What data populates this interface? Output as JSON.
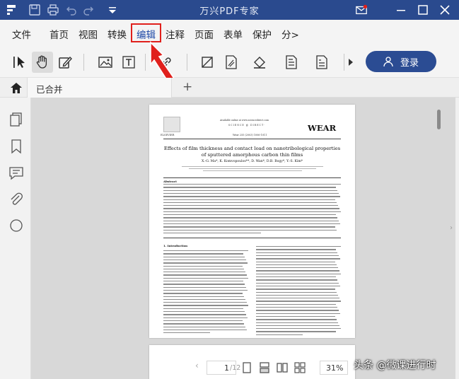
{
  "window": {
    "title": "万兴PDF专家"
  },
  "menu": {
    "file": "文件",
    "items": [
      "首页",
      "视图",
      "转换",
      "编辑",
      "注释",
      "页面",
      "表单",
      "保护"
    ],
    "more": "分>"
  },
  "toolbar": {
    "tools": [
      "select-arrow",
      "hand",
      "edit-pen",
      "image",
      "text-box",
      "link",
      "crop",
      "background",
      "watermark",
      "header-footer",
      "bates"
    ],
    "login_label": "登录"
  },
  "tabs": {
    "doc_tab_label": "已合并",
    "add_tab": "+"
  },
  "document": {
    "journal_info_top": "Available online at www.sciencedirect.com",
    "journal_name": "WEAR",
    "publisher": "ELSEVIER",
    "journal_citation": "Wear 255 (2003) 1006-1011",
    "paper_title": "Effects of film thickness and contact load on nanotribological properties of sputtered amorphous carbon thin films",
    "authors": "X.-G. Ma*, K. Komvopoulos**, D. Wan*, D.B. Bogy*, Y.-S. Kim*",
    "abstract_heading": "Abstract",
    "intro_heading": "1. Introduction"
  },
  "navigation": {
    "current_page": "1",
    "total_pages": "/12",
    "zoom": "31%"
  },
  "watermark_text": "头条 @微课进行时",
  "colors": {
    "titlebar": "#2a4a8e",
    "accent": "#2b4c93",
    "highlight": "#e0201c"
  }
}
